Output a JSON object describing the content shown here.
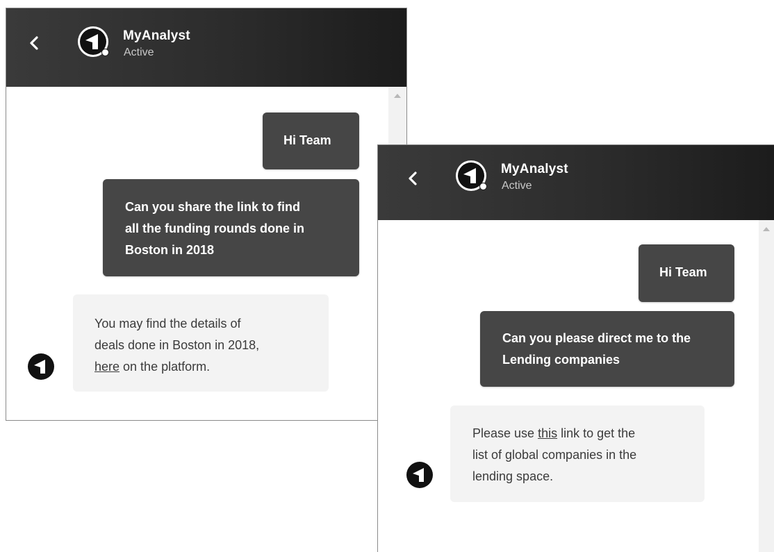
{
  "chat_1": {
    "header": {
      "title": "MyAnalyst",
      "status": "Active"
    },
    "messages": {
      "m1": "Hi Team",
      "m2_line1": "Can you share the link to find",
      "m2_line2": "all the funding rounds done in",
      "m2_line3": "Boston in 2018",
      "reply_line1": "You may find the details of",
      "reply_line2": "deals done in Boston in 2018,",
      "reply_link": "here",
      "reply_line3_rest": " on the platform."
    }
  },
  "chat_2": {
    "header": {
      "title": "MyAnalyst",
      "status": "Active"
    },
    "messages": {
      "m1": "Hi Team",
      "m2_line1": "Can you please direct me to the",
      "m2_line2": "Lending companies",
      "reply_line1_pre": "Please use ",
      "reply_link": "this",
      "reply_line1_post": " link to get the",
      "reply_line2": "list of global companies in the",
      "reply_line3": "lending space."
    }
  },
  "icons": {
    "back": "chevron-left-icon",
    "avatar": "myanalyst-logo-icon",
    "status": "online-dot-icon",
    "scroll": "scroll-up-arrow-icon"
  },
  "colors": {
    "header_dark": "#2c2c2c",
    "outgoing_bubble": "#464646",
    "incoming_bubble": "#f3f3f3"
  }
}
